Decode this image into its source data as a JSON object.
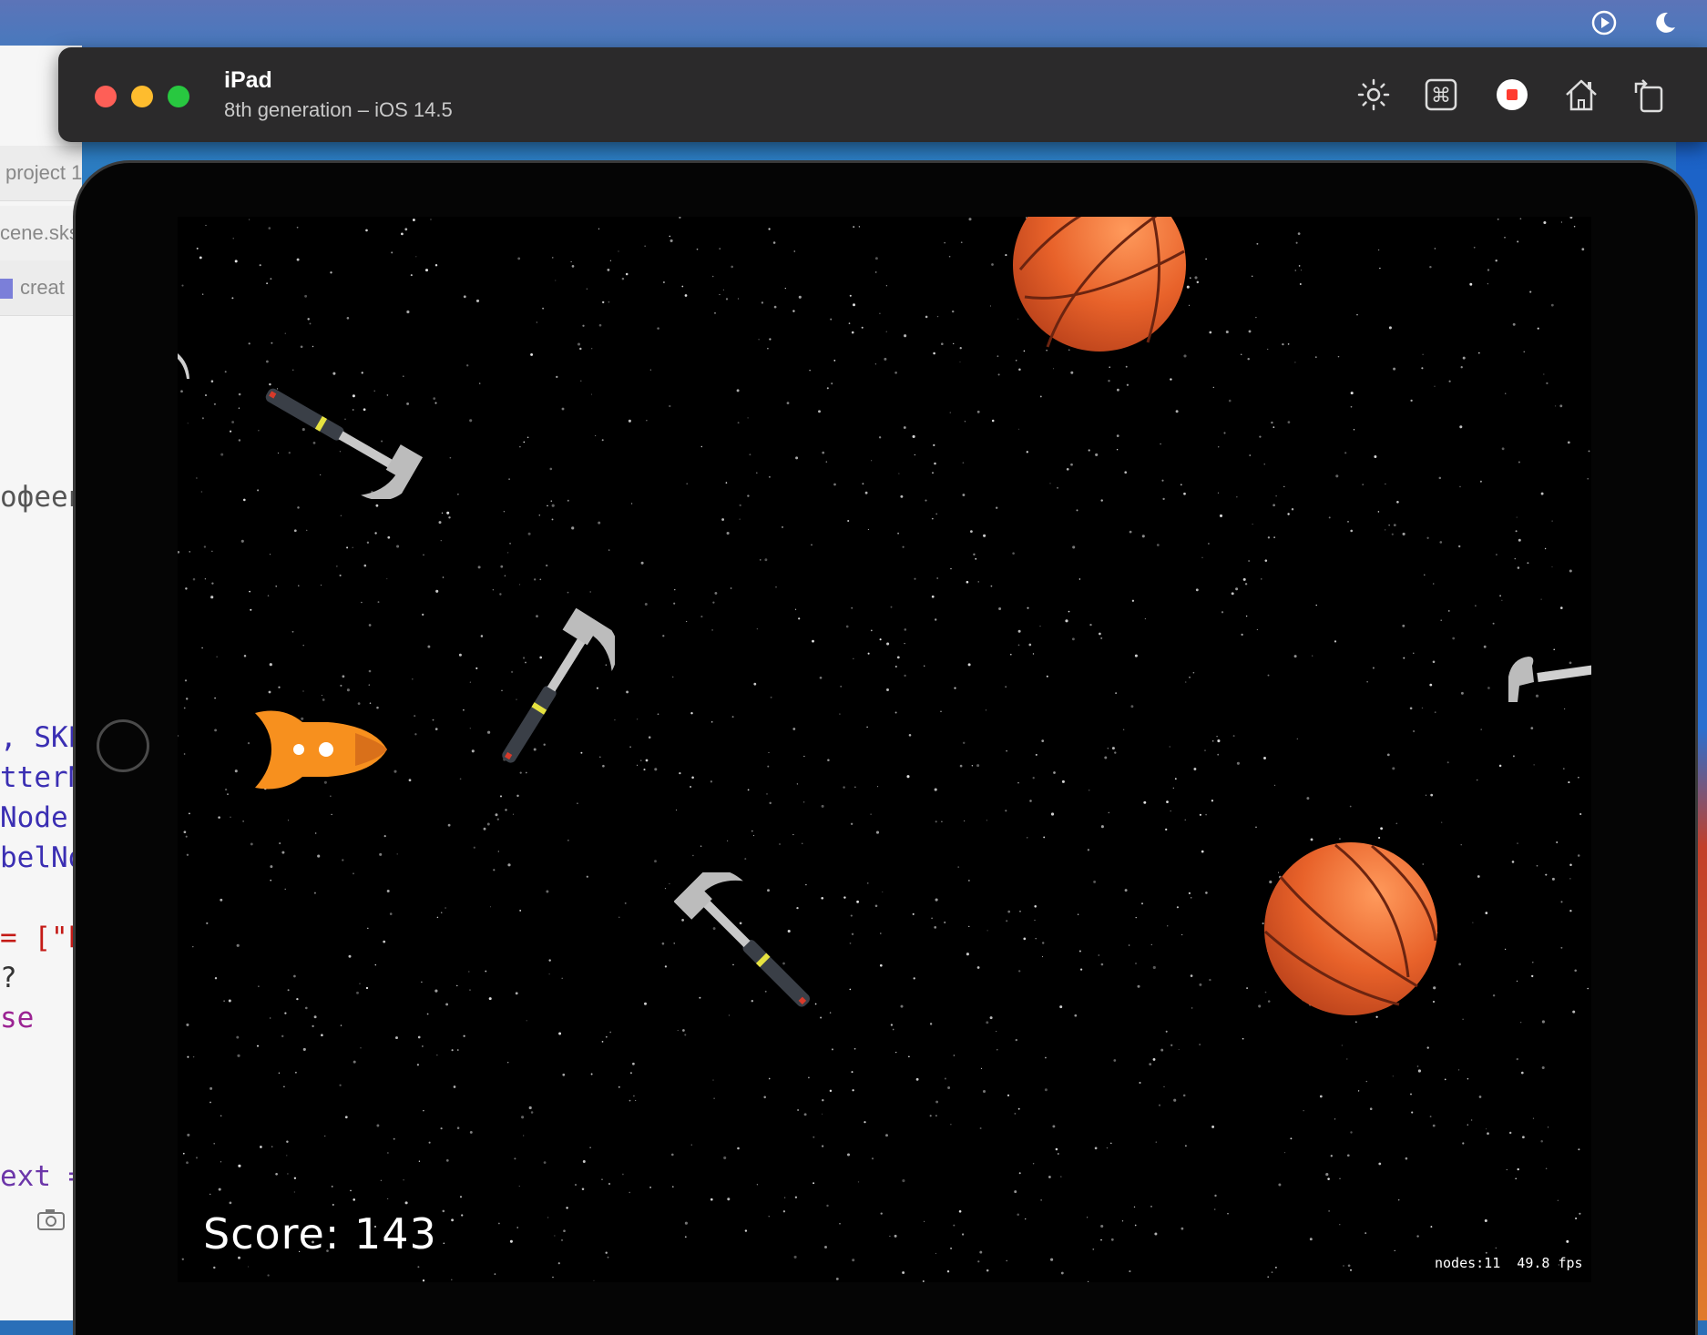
{
  "colors": {
    "window_bar": "#2b2a2b",
    "close": "#fe5f57",
    "minimize": "#febc2e",
    "zoom": "#28c840",
    "record_red": "#ff3b30",
    "ball_orange": "#e8622a",
    "rocket_orange": "#f7901e"
  },
  "menubar": {
    "icons": [
      "play-circle-icon",
      "moon-icon"
    ]
  },
  "xcode": {
    "tabs": [
      "project 1",
      "cene.sks",
      "creat"
    ],
    "code_lines": [
      {
        "text": "офеев",
        "color": "#555555"
      },
      {
        "text": ", SKP",
        "color": "#3b2fb3"
      },
      {
        "text": "tterN",
        "color": "#3b2fb3"
      },
      {
        "text": "Node!",
        "color": "#3b2fb3"
      },
      {
        "text": "belNo",
        "color": "#3b2fb3"
      },
      {
        "text": "= [\"b",
        "color": "#c41a16"
      },
      {
        "text": "?",
        "color": "#333333"
      },
      {
        "text": "se",
        "color": "#9b2393"
      },
      {
        "text": "ext =",
        "color": "#6c36a9"
      }
    ]
  },
  "simulator": {
    "device_name": "iPad",
    "device_subtitle": "8th generation – iOS 14.5",
    "toolbar_icons": [
      "brightness-icon",
      "command-icon",
      "record-icon",
      "home-icon",
      "rotate-icon"
    ]
  },
  "game": {
    "score_text": "Score: 143",
    "stats_text": "nodes:11  49.8 fps",
    "sprites": [
      "hammer",
      "hammer",
      "hammer",
      "hammer",
      "hammer",
      "basketball",
      "basketball",
      "rocket"
    ]
  }
}
